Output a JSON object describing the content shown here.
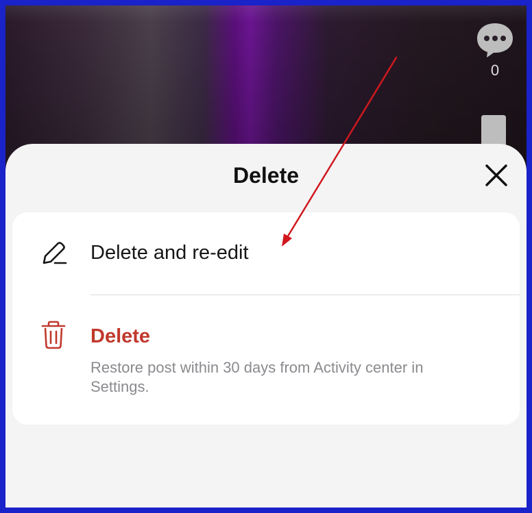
{
  "video": {
    "comment_icon": "comment-bubble-icon",
    "comment_count": "0",
    "bookmark_icon": "bookmark-icon"
  },
  "sheet": {
    "title": "Delete",
    "close_icon": "close-icon",
    "options": [
      {
        "icon": "pencil-icon",
        "label": "Delete and re-edit"
      },
      {
        "icon": "trash-icon",
        "label": "Delete",
        "description": "Restore post within 30 days from Activity center in Settings."
      }
    ]
  },
  "colors": {
    "destructive": "#c0392b",
    "annotation_arrow": "#d0181e",
    "border": "#1a22c9"
  }
}
